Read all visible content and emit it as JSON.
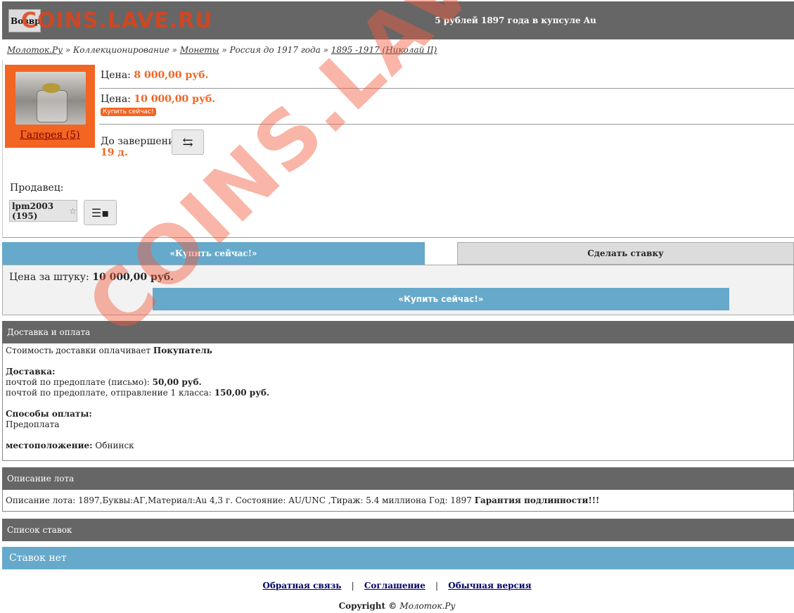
{
  "header": {
    "back_label": "Возврат",
    "title": "5 рублей 1897 года в купсуле Au",
    "logo_text": "COINS.LAVE.RU"
  },
  "breadcrumb": {
    "items": [
      "Молоток.Ру",
      "Коллекционирование",
      "Монеты",
      "Россия до 1917 года",
      "1895 -1917 (Николай II)"
    ],
    "separator": "»"
  },
  "lot": {
    "gallery_label": "Галерея (5)",
    "price_label": "Цена:",
    "price_value": "8 000,00 руб.",
    "buy_price_label": "Цена:",
    "buy_price_value": "10 000,00 руб.",
    "buy_small_label": "Купить сейчас!",
    "remaining_label": "До завершения",
    "remaining_value": "19 д.",
    "refresh_icon": "refresh-icon"
  },
  "seller": {
    "label": "Продавец:",
    "name": "lpm2003 (195)",
    "star_glyph": "☆",
    "info_icon": "seller-info-icon"
  },
  "tabs": {
    "buy_now": "«Купить сейчас!»",
    "bid": "Сделать ставку"
  },
  "buy_panel": {
    "unit_price_label": "Цена за штуку:",
    "unit_price_value": "10 000,00 руб.",
    "buy_button": "«Купить сейчас!»"
  },
  "delivery": {
    "title": "Доставка и оплата",
    "cost_text": "Стоимость доставки оплачивает",
    "cost_payer": "Покупатель",
    "delivery_label": "Доставка:",
    "option1_text": "почтой по предоплате (письмо):",
    "option1_price": "50,00 руб.",
    "option2_text": "почтой по предоплате, отправление 1 класса:",
    "option2_price": "150,00 руб.",
    "payment_label": "Способы оплаты:",
    "payment_value": "Предоплата",
    "location_label": "местоположение:",
    "location_value": "Обнинск"
  },
  "description": {
    "title": "Описание лота",
    "text": "Описание лота: 1897,Буквы:АГ,Материал:Au 4,3 г. Состояние: AU/UNC ,Тираж: 5.4 миллиона Год: 1897",
    "guarantee": "Гарантия подлинности!!!"
  },
  "bids": {
    "title": "Список ставок",
    "empty": "Ставок нет"
  },
  "footer": {
    "link_feedback": "Обратная связь",
    "link_agreement": "Соглашение",
    "link_normal": "Обычная версия",
    "separator": "|",
    "copyright_label": "Copyright ©",
    "copyright_site": "Молоток.Ру"
  },
  "watermark": {
    "text": "COINS.LAVE.RU"
  },
  "colors": {
    "header_bg": "#666666",
    "accent_orange": "#f26522",
    "accent_blue": "#66a9cb",
    "watermark": "#f25a3c"
  }
}
